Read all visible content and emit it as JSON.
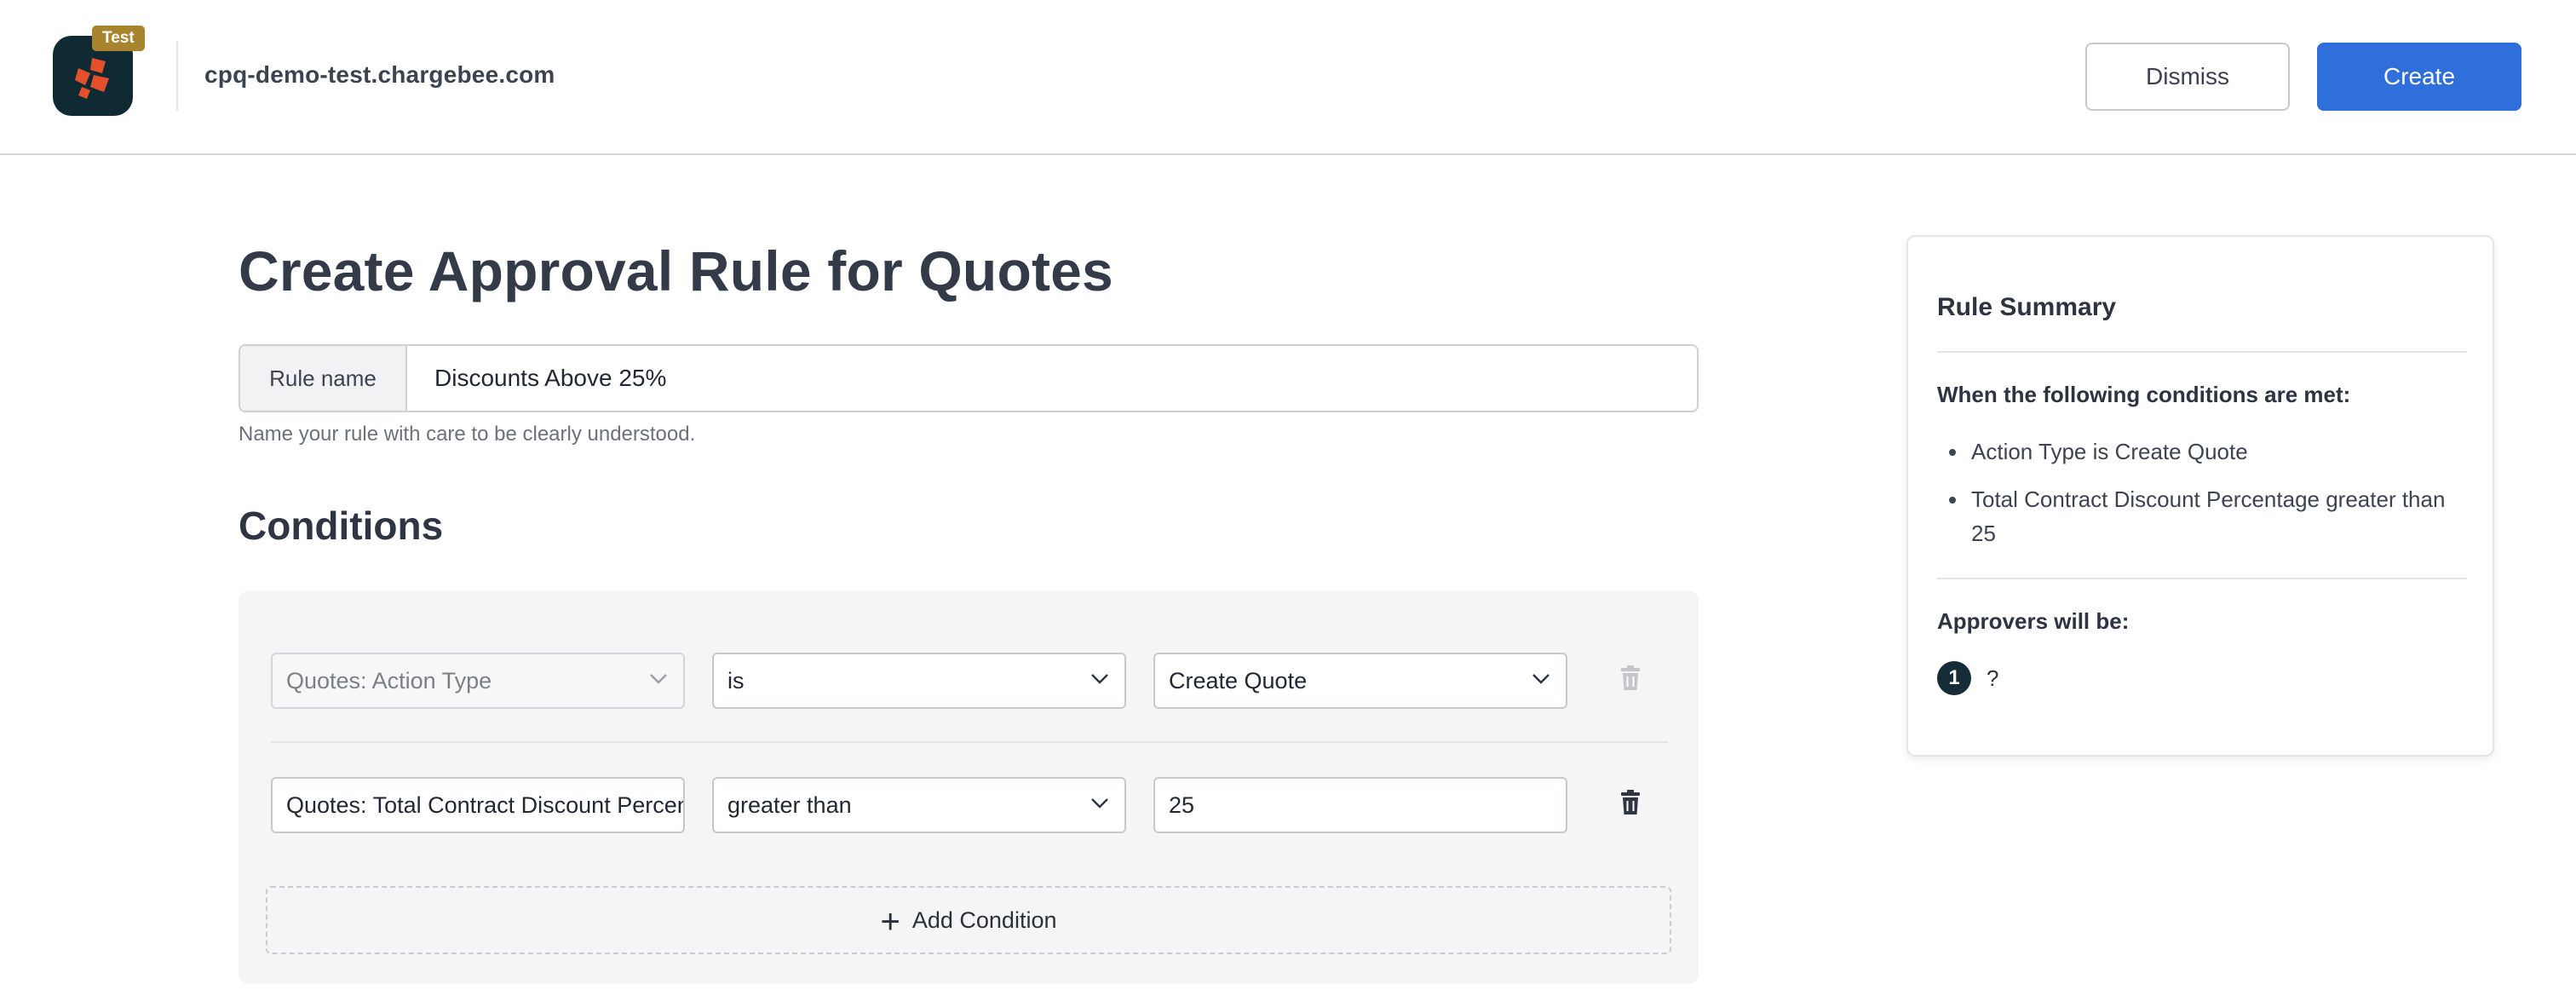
{
  "header": {
    "badge": "Test",
    "domain": "cpq-demo-test.chargebee.com",
    "dismiss_label": "Dismiss",
    "create_label": "Create"
  },
  "page": {
    "title": "Create Approval Rule for Quotes",
    "rule_name_label": "Rule name",
    "rule_name_value": "Discounts Above 25%",
    "help_text": "Name your rule with care to be clearly understood."
  },
  "conditions": {
    "title": "Conditions",
    "rows": [
      {
        "field": "Quotes: Action Type",
        "operator": "is",
        "value": "Create Quote"
      },
      {
        "field": "Quotes: Total Contract Discount Percentage",
        "operator": "greater than",
        "value": "25"
      }
    ],
    "add_label": "Add Condition"
  },
  "summary": {
    "title": "Rule Summary",
    "conditions_heading": "When the following conditions are met:",
    "items": [
      "Action Type is Create Quote",
      "Total Contract Discount Percentage greater than 25"
    ],
    "approvers_heading": "Approvers will be:",
    "approver_number": "1",
    "approver_name": "?"
  },
  "colors": {
    "primary": "#2f6fdc",
    "badge": "#a7842d",
    "logo_bg": "#0f2a33",
    "logo_mark": "#e4502c"
  },
  "icons": [
    "chargebee-logo",
    "chevron-down-icon",
    "trash-icon",
    "plus-icon"
  ]
}
